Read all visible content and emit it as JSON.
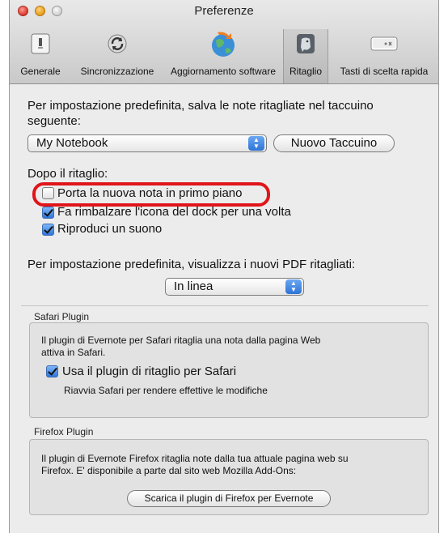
{
  "window": {
    "title": "Preferenze"
  },
  "toolbar": {
    "items": [
      {
        "label": "Generale",
        "icon": "switch-icon"
      },
      {
        "label": "Sincronizzazione",
        "icon": "sync-icon"
      },
      {
        "label": "Aggiornamento software",
        "icon": "globe-update-icon"
      },
      {
        "label": "Ritaglio",
        "icon": "elephant-icon",
        "selected": true
      },
      {
        "label": "Tasti di scelta rapida",
        "icon": "keyboard-key-icon"
      }
    ]
  },
  "clipping": {
    "default_notebook_text": "Per impostazione predefinita, salva le note ritagliate nel taccuino seguente:",
    "default_notebook_line1": "Per impostazione predefinita, salva le note ritagliate nel taccuino",
    "default_notebook_line2": "seguente:",
    "notebook_select": "My Notebook",
    "new_notebook_button": "Nuovo Taccuino",
    "after_clip_label": "Dopo il ritaglio:",
    "options": [
      {
        "label": "Porta la nuova nota in primo piano",
        "checked": false
      },
      {
        "label": "Fa rimbalzare l'icona del dock per una volta",
        "checked": true
      },
      {
        "label": "Riproduci un suono",
        "checked": true
      }
    ],
    "pdf_label": "Per impostazione predefinita, visualizza i nuovi PDF ritagliati:",
    "pdf_select": "In linea"
  },
  "safari": {
    "title": "Safari Plugin",
    "desc_line1": "Il plugin di Evernote per Safari ritaglia una nota dalla pagina Web",
    "desc_line2": "attiva in Safari.",
    "checkbox_label": "Usa il plugin di ritaglio per Safari",
    "checked": true,
    "note": "Riavvia Safari per rendere effettive le modifiche"
  },
  "firefox": {
    "title": "Firefox Plugin",
    "desc_line1": "Il plugin di Evernote Firefox ritaglia note dalla tua attuale pagina web su",
    "desc_line2": "Firefox.  E' disponibile a parte dal sito web Mozilla Add-Ons:",
    "download_button": "Scarica il plugin di Firefox per Evernote"
  },
  "colors": {
    "highlight": "#e0151a",
    "checkbox_checked": "#2f77d8"
  }
}
